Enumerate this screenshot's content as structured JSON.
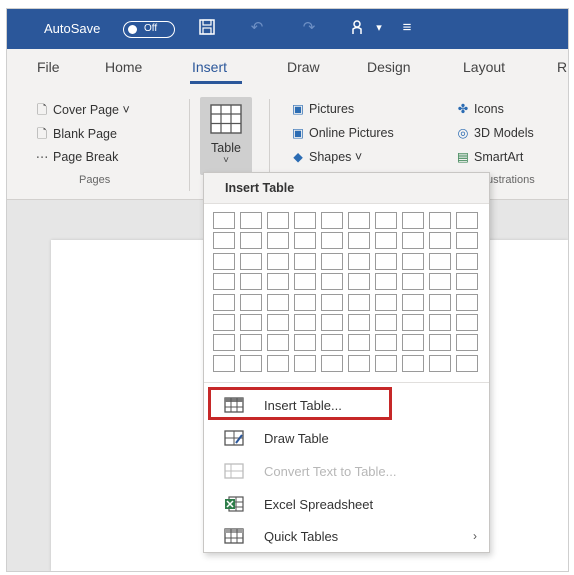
{
  "titlebar": {
    "autosave_label": "AutoSave",
    "autosave_state": "Off",
    "icons": [
      "save-icon",
      "undo-icon",
      "redo-icon",
      "touch-mode-icon",
      "customize-icon"
    ]
  },
  "ribbon": {
    "tabs": [
      {
        "label": "File"
      },
      {
        "label": "Home"
      },
      {
        "label": "Insert"
      },
      {
        "label": "Draw"
      },
      {
        "label": "Design"
      },
      {
        "label": "Layout"
      },
      {
        "label": "R"
      }
    ],
    "pages_group": {
      "label": "Pages",
      "items": [
        {
          "label": "Cover Page ˅"
        },
        {
          "label": "Blank Page"
        },
        {
          "label": "Page Break"
        }
      ]
    },
    "table_button": {
      "label": "Table",
      "arrow": "˅"
    },
    "illustrations_group": {
      "label": "Illustrations",
      "visible_label": "ustrations",
      "items": [
        {
          "label": "Pictures"
        },
        {
          "label": "Online Pictures"
        },
        {
          "label": "Shapes ˅"
        },
        {
          "label": "Icons"
        },
        {
          "label": "3D Models"
        },
        {
          "label": "SmartArt"
        }
      ]
    }
  },
  "dropdown": {
    "title": "Insert Table",
    "grid": {
      "columns": 10,
      "rows": 8
    },
    "menu": [
      {
        "label": "Insert Table...",
        "icon": "table-icon",
        "disabled": false,
        "highlighted": true
      },
      {
        "label": "Draw Table",
        "icon": "draw-table-icon",
        "disabled": false
      },
      {
        "label": "Convert Text to Table...",
        "icon": "convert-text-icon",
        "disabled": true
      },
      {
        "label": "Excel Spreadsheet",
        "icon": "excel-icon",
        "disabled": false
      },
      {
        "label": "Quick Tables",
        "icon": "quick-tables-icon",
        "disabled": false,
        "submenu_arrow": "›"
      }
    ]
  },
  "colors": {
    "titlebar": "#2b579a",
    "ribbon": "#f3f2f1",
    "highlight": "#c62828",
    "accent": "#2b579a"
  }
}
